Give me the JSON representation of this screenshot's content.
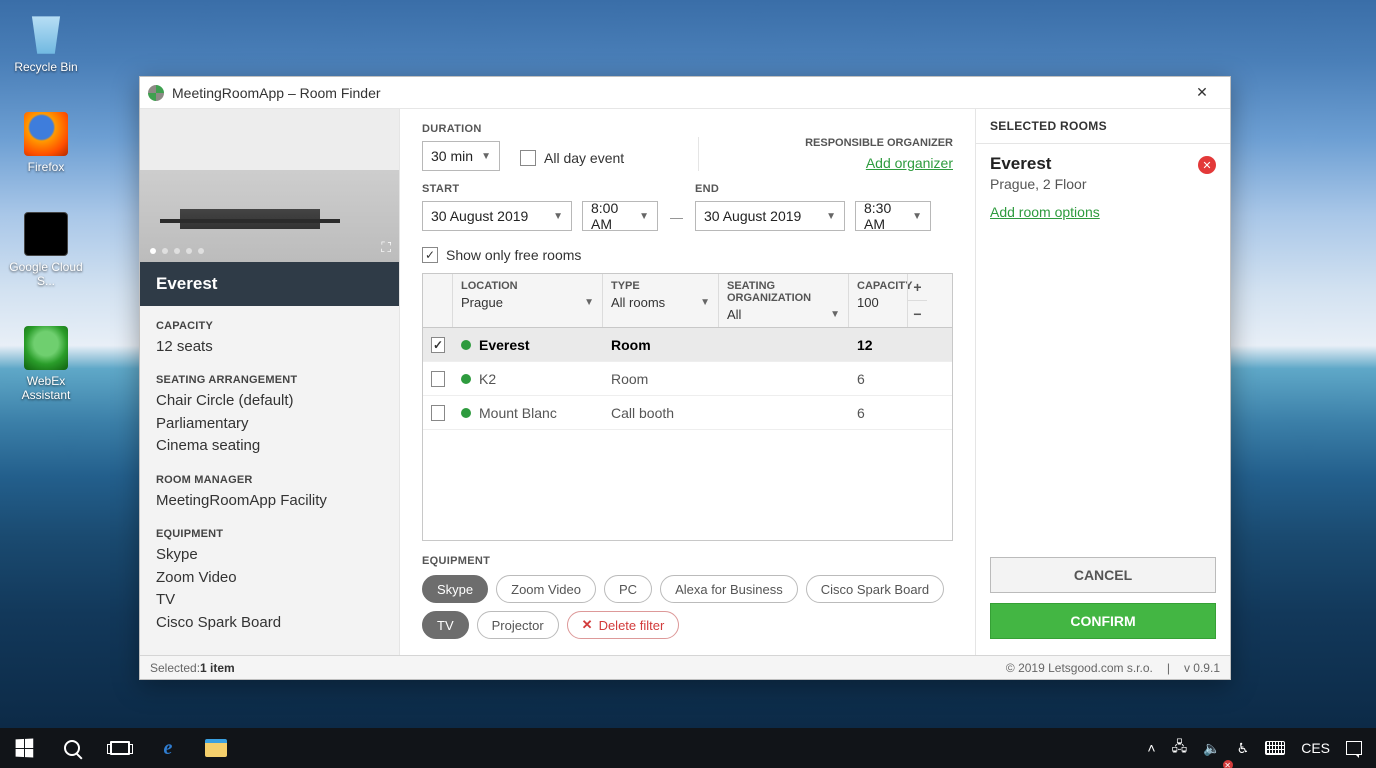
{
  "window": {
    "title": "MeetingRoomApp – Room Finder"
  },
  "desktop": {
    "recycle": "Recycle Bin",
    "firefox": "Firefox",
    "gcloud": "Google Cloud S...",
    "webex": "WebEx Assistant"
  },
  "form": {
    "duration_label": "DURATION",
    "duration_value": "30 min",
    "all_day_label": "All day event",
    "start_label": "START",
    "start_date": "30 August 2019",
    "start_time": "8:00 AM",
    "end_label": "END",
    "end_date": "30 August 2019",
    "end_time": "8:30 AM",
    "responsible_label": "RESPONSIBLE ORGANIZER",
    "add_organizer": "Add organizer",
    "show_free_label": "Show only free rooms"
  },
  "grid_headers": {
    "location": "LOCATION",
    "location_value": "Prague",
    "type": "TYPE",
    "type_value": "All rooms",
    "seating": "SEATING ORGANIZATION",
    "seating_value": "All",
    "capacity": "CAPACITY",
    "capacity_value": "100"
  },
  "rooms": [
    {
      "name": "Everest",
      "type": "Room",
      "capacity": "12",
      "selected": true
    },
    {
      "name": "K2",
      "type": "Room",
      "capacity": "6",
      "selected": false
    },
    {
      "name": "Mount Blanc",
      "type": "Call booth",
      "capacity": "6",
      "selected": false
    }
  ],
  "equipment_label": "EQUIPMENT",
  "chips": {
    "skype": "Skype",
    "zoom": "Zoom Video",
    "pc": "PC",
    "alexa": "Alexa for Business",
    "cisco": "Cisco Spark Board",
    "tv": "TV",
    "projector": "Projector",
    "delete": "Delete filter"
  },
  "selected_panel": {
    "header": "SELECTED ROOMS",
    "room_name": "Everest",
    "room_loc": "Prague, 2 Floor",
    "add_opts": "Add room options",
    "cancel": "CANCEL",
    "confirm": "CONFIRM"
  },
  "details": {
    "room_title": "Everest",
    "capacity_label": "CAPACITY",
    "capacity": "12 seats",
    "seating_label": "SEATING ARRANGEMENT",
    "seating1": "Chair Circle (default)",
    "seating2": "Parliamentary",
    "seating3": "Cinema seating",
    "manager_label": "ROOM MANAGER",
    "manager": "MeetingRoomApp Facility",
    "equip_label": "EQUIPMENT",
    "equip1": "Skype",
    "equip2": "Zoom Video",
    "equip3": "TV",
    "equip4": "Cisco Spark Board"
  },
  "status": {
    "selected_label": "Selected: ",
    "selected_count": "1 item",
    "copyright": "© 2019 Letsgood.com s.r.o.",
    "version": "v 0.9.1"
  },
  "taskbar": {
    "lang": "CES"
  }
}
